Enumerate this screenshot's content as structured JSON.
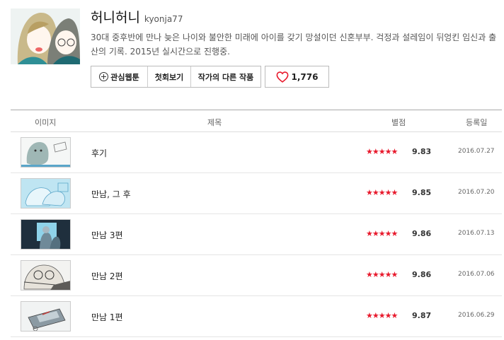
{
  "header": {
    "title": "허니허니",
    "author": "kyonja77",
    "description": "30대 중후반에 만나 늦은 나이와 불안한 미래에 아이를 갖기 망설이던 신혼부부. 걱정과 설레임이 뒤엉킨 임신과 출산의 기록. 2015년 실시간으로 진행중.",
    "buttons": {
      "favorite": "관심웹툰",
      "first_episode": "첫회보기",
      "other_works": "작가의 다른 작품"
    },
    "likes": "1,776",
    "heart_color": "#e8192c"
  },
  "table": {
    "columns": {
      "image": "이미지",
      "title": "제목",
      "rating": "별점",
      "date": "등록일"
    },
    "rows": [
      {
        "title": "후기",
        "stars": "★★★★★",
        "score": "9.83",
        "date": "2016.07.27"
      },
      {
        "title": "만남, 그 후",
        "stars": "★★★★★",
        "score": "9.85",
        "date": "2016.07.20"
      },
      {
        "title": "만남 3편",
        "stars": "★★★★★",
        "score": "9.86",
        "date": "2016.07.13"
      },
      {
        "title": "만남 2편",
        "stars": "★★★★★",
        "score": "9.86",
        "date": "2016.07.06"
      },
      {
        "title": "만남 1편",
        "stars": "★★★★★",
        "score": "9.87",
        "date": "2016.06.29"
      }
    ]
  }
}
